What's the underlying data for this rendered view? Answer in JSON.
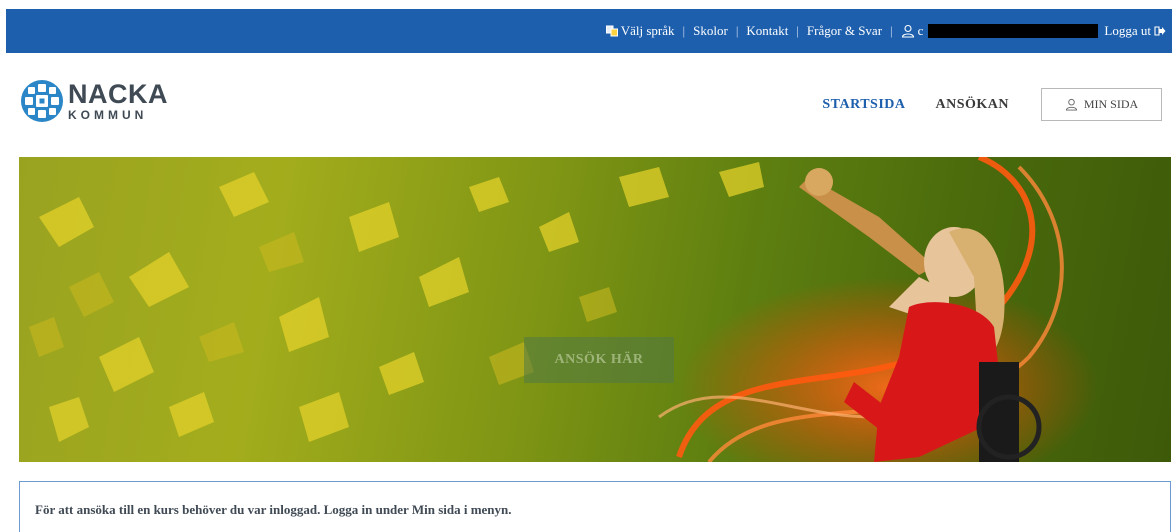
{
  "topbar": {
    "language_label": "Välj språk",
    "schools_label": "Skolor",
    "contact_label": "Kontakt",
    "faq_label": "Frågor & Svar",
    "user_prefix": "c",
    "logout_label": "Logga ut",
    "separator": "|",
    "background_color": "#1d5fad"
  },
  "logo": {
    "name": "NACKA",
    "subtitle": "KOMMUN",
    "icon": "nacka-logo-globe-icon"
  },
  "nav": {
    "start_label": "STARTSIDA",
    "application_label": "ANSÖKAN",
    "my_page_label": "MIN SIDA",
    "active_color": "#1d5fad"
  },
  "hero": {
    "cta_label": "ANSÖK HÄR"
  },
  "info": {
    "message": "För att ansöka till en kurs behöver du var inloggad. Logga in under Min sida i menyn."
  }
}
